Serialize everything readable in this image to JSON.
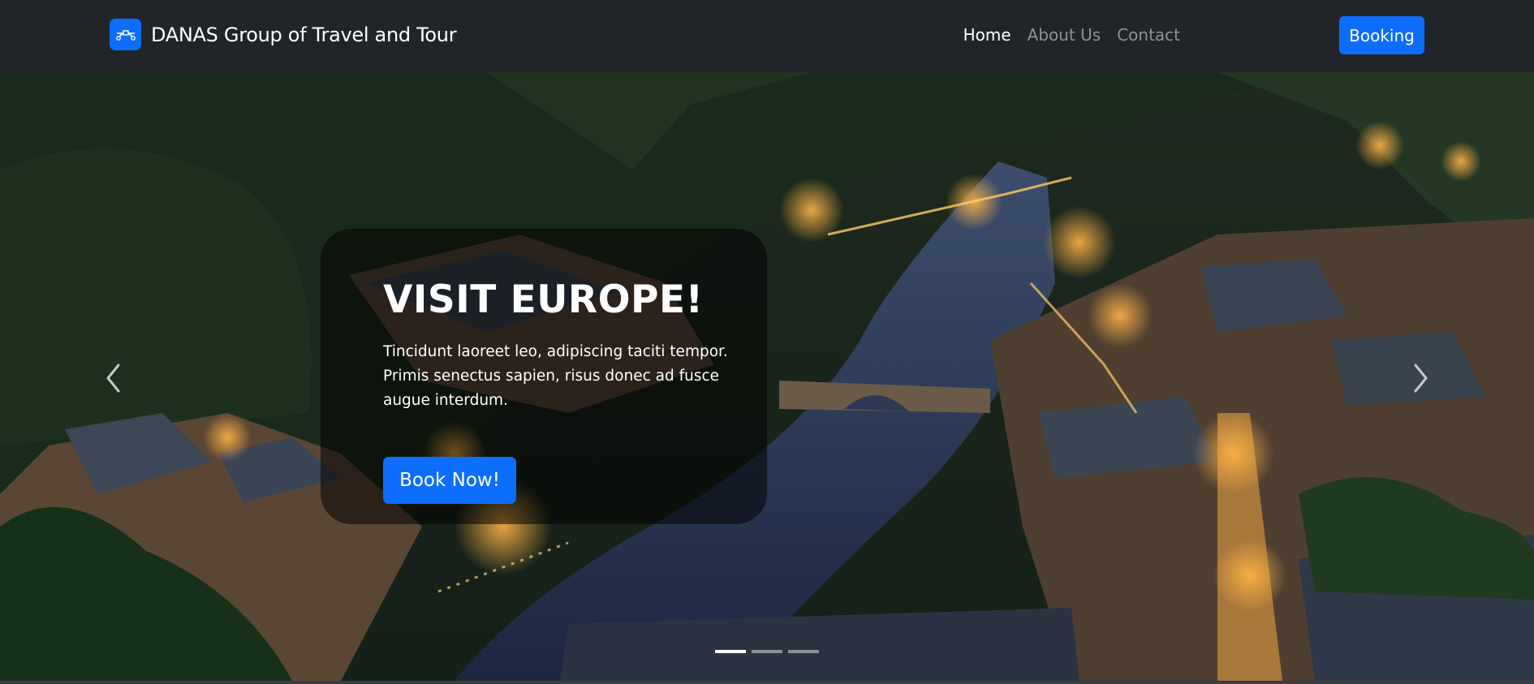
{
  "navbar": {
    "brand_title": "DANAS Group of Travel and Tour",
    "brand_icon": "bezier-icon",
    "links": [
      {
        "label": "Home",
        "active": true
      },
      {
        "label": "About Us",
        "active": false
      },
      {
        "label": "Contact",
        "active": false
      }
    ],
    "booking_label": "Booking"
  },
  "hero": {
    "title": "VISIT EUROPE!",
    "text": "Tincidunt laoreet leo, adipiscing taciti tempor. Primis senectus sapien, risus donec ad fusce augue interdum.",
    "cta_label": "Book Now!",
    "indicators": [
      {
        "active": true
      },
      {
        "active": false
      },
      {
        "active": false
      }
    ]
  },
  "colors": {
    "navbar_bg": "#212529",
    "primary": "#0d6efd",
    "nav_inactive": "#8e9296"
  }
}
